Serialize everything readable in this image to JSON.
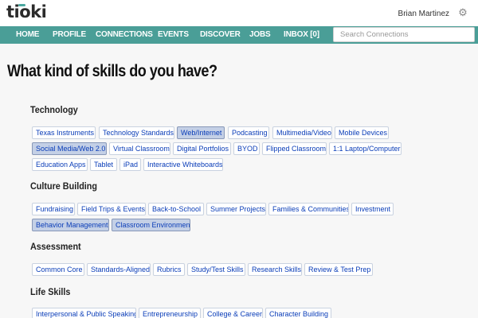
{
  "header": {
    "logo": "tioki",
    "user_name": "Brian Martinez",
    "gear_icon": "gear-icon"
  },
  "nav": {
    "items": [
      "HOME",
      "PROFILE",
      "CONNECTIONS",
      "EVENTS",
      "DISCOVER",
      "JOBS",
      "INBOX [0]"
    ],
    "search_placeholder": "Search Connections"
  },
  "main": {
    "title": "What kind of skills do you have?",
    "sections": [
      {
        "title": "Technology",
        "chips": [
          {
            "label": "Texas Instruments",
            "selected": false
          },
          {
            "label": "Technology Standards",
            "selected": false
          },
          {
            "label": "Web/Internet",
            "selected": true
          },
          {
            "label": "Podcasting",
            "selected": false
          },
          {
            "label": "Multimedia/Video",
            "selected": false
          },
          {
            "label": "Mobile Devices",
            "selected": false
          },
          {
            "label": "Social Media/Web 2.0",
            "selected": true
          },
          {
            "label": "Virtual Classroom",
            "selected": false
          },
          {
            "label": "Digital Portfolios",
            "selected": false
          },
          {
            "label": "BYOD",
            "selected": false
          },
          {
            "label": "Flipped Classroom",
            "selected": false
          },
          {
            "label": "1:1 Laptop/Computer",
            "selected": false
          },
          {
            "label": "Education Apps",
            "selected": false
          },
          {
            "label": "Tablet",
            "selected": false
          },
          {
            "label": "iPad",
            "selected": false
          },
          {
            "label": "Interactive Whiteboards",
            "selected": false
          }
        ]
      },
      {
        "title": "Culture Building",
        "chips": [
          {
            "label": "Fundraising",
            "selected": false
          },
          {
            "label": "Field Trips & Events",
            "selected": false
          },
          {
            "label": "Back-to-School",
            "selected": false
          },
          {
            "label": "Summer Projects",
            "selected": false
          },
          {
            "label": "Families & Communities",
            "selected": false
          },
          {
            "label": "Investment",
            "selected": false
          },
          {
            "label": "Behavior Management",
            "selected": true
          },
          {
            "label": "Classroom Environment",
            "selected": true
          }
        ]
      },
      {
        "title": "Assessment",
        "chips": [
          {
            "label": "Common Core",
            "selected": false
          },
          {
            "label": "Standards-Aligned",
            "selected": false
          },
          {
            "label": "Rubrics",
            "selected": false
          },
          {
            "label": "Study/Test Skills",
            "selected": false
          },
          {
            "label": "Research Skills",
            "selected": false
          },
          {
            "label": "Review & Test Prep",
            "selected": false
          }
        ]
      },
      {
        "title": "Life Skills",
        "chips": [
          {
            "label": "Interpersonal & Public Speaking",
            "selected": false
          },
          {
            "label": "Entrepreneurship",
            "selected": false
          },
          {
            "label": "College & Career",
            "selected": false
          },
          {
            "label": "Character Building",
            "selected": false
          }
        ]
      }
    ]
  },
  "colors": {
    "nav_bg": "#4a9e97",
    "chip_text": "#0a3db8",
    "chip_selected_bg": "#c4d0e6"
  }
}
